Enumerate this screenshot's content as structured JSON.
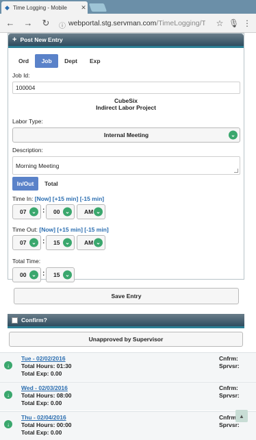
{
  "browser": {
    "tab_title": "Time Logging - Mobile",
    "url_host": "webportal.stg.servman.com",
    "url_path": "/TimeLogging/Time/In"
  },
  "entry_panel": {
    "title": "Post New Entry",
    "type_tabs": [
      "Ord",
      "Job",
      "Dept",
      "Exp"
    ],
    "active_type": "Job",
    "job_id_label": "Job Id:",
    "job_id_value": "100004",
    "company": "CubeSix",
    "project": "Indirect Labor Project",
    "labor_type_label": "Labor Type:",
    "labor_type_value": "Internal Meeting",
    "description_label": "Description:",
    "description_value": "Morning Meeting",
    "mode_tabs": [
      "In/Out",
      "Total"
    ],
    "active_mode": "In/Out",
    "time_in": {
      "label": "Time In:",
      "links": [
        "[Now]",
        "[+15 min]",
        "[-15 min]"
      ],
      "hour": "07",
      "minute": "00",
      "ampm": "AM"
    },
    "time_out": {
      "label": "Time Out:",
      "links": [
        "[Now]",
        "[+15 min]",
        "[-15 min]"
      ],
      "hour": "07",
      "minute": "15",
      "ampm": "AM"
    },
    "total_time": {
      "label": "Total Time:",
      "hours": "00",
      "minutes": "15"
    },
    "save_label": "Save Entry"
  },
  "confirm": {
    "title": "Confirm?",
    "status": "Unapproved by Supervisor"
  },
  "days": [
    {
      "date": "Tue - 02/02/2016",
      "hours": "Total Hours: 01:30",
      "exp": "Total Exp: 0.00",
      "cnfrm": "Cnfrm:",
      "sprvsr": "Sprvsr:"
    },
    {
      "date": "Wed - 02/03/2016",
      "hours": "Total Hours: 08:00",
      "exp": "Total Exp: 0.00",
      "cnfrm": "Cnfrm:",
      "sprvsr": "Sprvsr:"
    },
    {
      "date": "Thu - 02/04/2016",
      "hours": "Total Hours: 00:00",
      "exp": "Total Exp: 0.00",
      "cnfrm": "Cnfrm:",
      "sprvsr": "Sprvsr:"
    }
  ],
  "colors": {
    "accent": "#2c7f95",
    "brand_blue": "#5a82c9",
    "green": "#3aa76d",
    "link": "#2a6db0"
  },
  "icons": {
    "chevron": "chevron-down-icon",
    "expand": "arrow-down-circle-icon",
    "scroll": "caret-up-icon"
  }
}
